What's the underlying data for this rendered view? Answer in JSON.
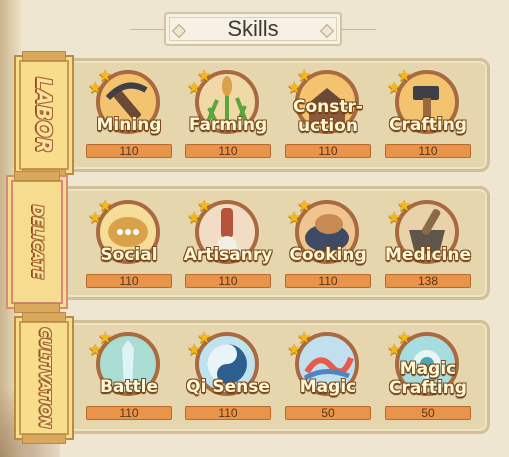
{
  "title": "Skills",
  "groups": [
    {
      "label": "LABOR",
      "skills": [
        {
          "name": "Mining",
          "level": "110",
          "icon": "pickaxe-icon"
        },
        {
          "name": "Farming",
          "level": "110",
          "icon": "wheat-icon"
        },
        {
          "name": "Constr-\nuction",
          "level": "110",
          "icon": "construction-icon"
        },
        {
          "name": "Crafting",
          "level": "110",
          "icon": "hammer-icon"
        }
      ]
    },
    {
      "label": "DELICATE",
      "skills": [
        {
          "name": "Social",
          "level": "110",
          "icon": "speech-bubble-icon"
        },
        {
          "name": "Artisanry",
          "level": "110",
          "icon": "brush-icon"
        },
        {
          "name": "Cooking",
          "level": "110",
          "icon": "cooking-pot-icon"
        },
        {
          "name": "Medicine",
          "level": "138",
          "icon": "mortar-icon"
        }
      ]
    },
    {
      "label": "CULTIVATION",
      "skills": [
        {
          "name": "Battle",
          "level": "110",
          "icon": "sword-icon"
        },
        {
          "name": "Qi Sense",
          "level": "110",
          "icon": "yin-yang-icon"
        },
        {
          "name": "Magic",
          "level": "50",
          "icon": "dragon-icon"
        },
        {
          "name": "Magic\nCrafting",
          "level": "50",
          "icon": "magic-crafting-icon"
        }
      ]
    }
  ]
}
